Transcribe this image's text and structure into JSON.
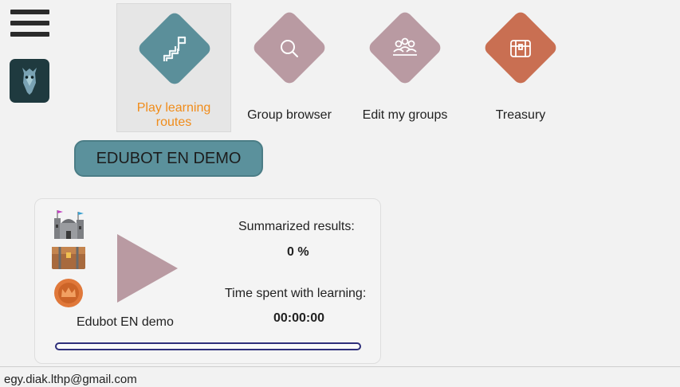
{
  "nav": {
    "items": [
      {
        "label": "Play learning routes",
        "icon": "route-flag-icon",
        "color": "#5b8f9a",
        "active": true
      },
      {
        "label": "Group browser",
        "icon": "search-icon",
        "color": "#b99aa2",
        "active": false
      },
      {
        "label": "Edit my groups",
        "icon": "users-icon",
        "color": "#b99aa2",
        "active": false
      },
      {
        "label": "Treasury",
        "icon": "treasure-chest-icon",
        "color": "#c96f52",
        "active": false
      }
    ]
  },
  "group": {
    "button_label": "EDUBOT EN DEMO"
  },
  "route_card": {
    "name": "Edubot EN demo",
    "summarized_label": "Summarized results:",
    "summarized_value": "0 %",
    "time_label": "Time spent with learning:",
    "time_value": "00:00:00",
    "progress": 0
  },
  "footer": {
    "email": "egy.diak.lthp@gmail.com"
  },
  "colors": {
    "accent_active": "#f08c1a",
    "group_button": "#5b919c",
    "progress_border": "#2e2f7a",
    "play": "#b99aa2"
  }
}
